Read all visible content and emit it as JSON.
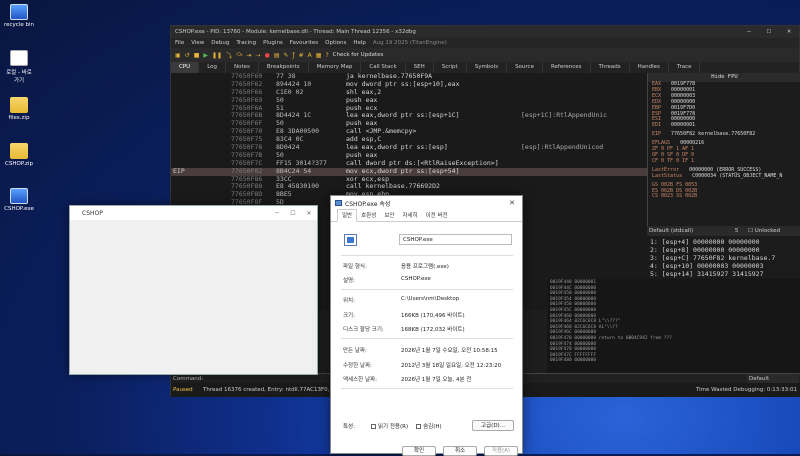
{
  "desktop": {
    "icons": [
      {
        "label": "recycle bin",
        "type": "app"
      },
      {
        "label": "로컬 - 바로 가기",
        "type": "doc"
      },
      {
        "label": "files.zip",
        "type": "folder"
      },
      {
        "label": "CSHOP.zip",
        "type": "folder"
      },
      {
        "label": "CSHOP.exe",
        "type": "app"
      }
    ]
  },
  "debugger": {
    "title": "CSHOP.exe - PID: 13760 - Module: kernelbase.dll - Thread: Main Thread 12356 - x32dbg",
    "menu": [
      "File",
      "View",
      "Debug",
      "Tracing",
      "Plugins",
      "Favourites",
      "Options",
      "Help",
      "Aug 19 2025 (TitanEngine)"
    ],
    "toolbar_text": "Check for Updates",
    "tabs": [
      "CPU",
      "Log",
      "Notes",
      "Breakpoints",
      "Memory Map",
      "Call Stack",
      "SEH",
      "Script",
      "Symbols",
      "Source",
      "References",
      "Threads",
      "Handles",
      "Trace"
    ],
    "eip_label": "EIP",
    "disasm": [
      {
        "addr": "77650F60",
        "bytes": "77 38",
        "instr": "ja kernelbase.77650F9A",
        "cmt": "",
        "cls": "kw-jmp"
      },
      {
        "addr": "77650F62",
        "bytes": "894424 10",
        "instr": "mov dword ptr ss:[esp+10],eax",
        "cmt": "",
        "cls": "kw-mov"
      },
      {
        "addr": "77650F66",
        "bytes": "C1E0 02",
        "instr": "shl eax,2",
        "cmt": "",
        "cls": "kw-mov"
      },
      {
        "addr": "77650F69",
        "bytes": "50",
        "instr": "push eax",
        "cmt": "",
        "cls": "kw-push"
      },
      {
        "addr": "77650F6A",
        "bytes": "51",
        "instr": "push ecx",
        "cmt": "",
        "cls": "kw-push"
      },
      {
        "addr": "77650F6B",
        "bytes": "8D4424 1C",
        "instr": "lea eax,dword ptr ss:[esp+1C]",
        "cmt": "[esp+1C]:RtlAppendUnic",
        "cls": "kw-mov"
      },
      {
        "addr": "77650F6F",
        "bytes": "50",
        "instr": "push eax",
        "cmt": "",
        "cls": "kw-push"
      },
      {
        "addr": "77650F70",
        "bytes": "E8 3DA00500",
        "instr": "call <JMP.&memcpy>",
        "cmt": "",
        "cls": "kw-call"
      },
      {
        "addr": "77650F75",
        "bytes": "83C4 0C",
        "instr": "add esp,C",
        "cmt": "",
        "cls": "kw-mov"
      },
      {
        "addr": "77650F78",
        "bytes": "8D0424",
        "instr": "lea eax,dword ptr ss:[esp]",
        "cmt": "[esp]:RtlAppendUnicod",
        "cls": "kw-mov"
      },
      {
        "addr": "77650F7B",
        "bytes": "50",
        "instr": "push eax",
        "cmt": "",
        "cls": "kw-push"
      },
      {
        "addr": "77650F7C",
        "bytes": "FF15 3014?377",
        "instr": "call dword ptr ds:[<RtlRaiseException>]",
        "cmt": "",
        "cls": "kw-call"
      },
      {
        "addr": "77650F82",
        "bytes": "8B4C24 54",
        "instr": "mov ecx,dword ptr ss:[esp+54]",
        "cmt": "",
        "cls": "kw-mov",
        "hl": true
      },
      {
        "addr": "77650F86",
        "bytes": "33CC",
        "instr": "xor ecx,esp",
        "cmt": "",
        "cls": "kw-mov"
      },
      {
        "addr": "77650F88",
        "bytes": "E8 45830100",
        "instr": "call kernelbase.776692D2",
        "cmt": "",
        "cls": "kw-call"
      },
      {
        "addr": "77650F8D",
        "bytes": "8BE5",
        "instr": "mov esp,ebp",
        "cmt": "",
        "cls": "kw-mov"
      },
      {
        "addr": "77650F8F",
        "bytes": "5D",
        "instr": "pop ebp",
        "cmt": "",
        "cls": "kw-push"
      },
      {
        "addr": "77650F90",
        "bytes": "C2",
        "instr": "",
        "cmt": "",
        "cls": "kw-mov"
      },
      {
        "addr": "77650F93",
        "bytes": "E",
        "instr": "",
        "cmt": "",
        "cls": "kw-mov"
      },
      {
        "addr": "77650F95",
        "bytes": "E",
        "instr": "",
        "cmt": "",
        "cls": "kw-mov"
      },
      {
        "addr": "77650F98",
        "bytes": "E",
        "instr": "",
        "cmt": "",
        "cls": "kw-mov"
      }
    ],
    "regs_header": "Hide FPU",
    "registers": [
      {
        "n": "EAX",
        "v": "0019F778"
      },
      {
        "n": "EBX",
        "v": "00000001"
      },
      {
        "n": "ECX",
        "v": "00000003"
      },
      {
        "n": "EDX",
        "v": "00000000"
      },
      {
        "n": "EBP",
        "v": "0019F7D0"
      },
      {
        "n": "ESP",
        "v": "0019F778"
      },
      {
        "n": "ESI",
        "v": "00000000"
      },
      {
        "n": "EDI",
        "v": "00000001"
      },
      {
        "n": "",
        "v": ""
      },
      {
        "n": "EIP",
        "v": "77650F82   kernelbase.77650F82"
      },
      {
        "n": "",
        "v": ""
      },
      {
        "n": "EFLAGS",
        "v": "00000216"
      },
      {
        "n": "ZF 0  PF 1  AF 1",
        "v": ""
      },
      {
        "n": "OF 0  SF 0  DF 0",
        "v": ""
      },
      {
        "n": "CF 0  TF 0  IF 1",
        "v": ""
      },
      {
        "n": "",
        "v": ""
      },
      {
        "n": "LastError",
        "v": "00000000 (ERROR_SUCCESS)"
      },
      {
        "n": "LastStatus",
        "v": "C0000034 (STATUS_OBJECT_NAME_N"
      },
      {
        "n": "",
        "v": ""
      },
      {
        "n": "GS 002B  FS 0053",
        "v": ""
      },
      {
        "n": "ES 002B  DS 002B",
        "v": ""
      },
      {
        "n": "CS 0023  SS 002B",
        "v": ""
      }
    ],
    "stack_default": "Default (stdcall)",
    "stack_count": "5",
    "unlocked": "Unlocked",
    "stack_args": [
      "1: [esp+4] 00000000 00000000",
      "2: [esp+8] 00000000 00000000",
      "3: [esp+C] 77650F82 kernelbase.7",
      "4: [esp+10] 00000003 00000003",
      "5: [esp+14] 31415927 31415927"
    ],
    "dump_lines": [
      "0019F448 00000001",
      "0019F44C 00000000",
      "0019F450 00000000",
      "0019F454 00000000",
      "0019F458 00000000",
      "0019F45C 00000000",
      "0019F460 00000000",
      "0019F464 02C6C6C8  L\"\\\\???\"",
      "0019F468 02C6C6C8  AL\"\\\\??",
      "0019F46C 00000000",
      "0019F470 00000000  return to 0B04C942 from ???",
      "0019F474 00000000",
      "0019F478 00000000",
      "0019F47C FFFFFFFF",
      "0019F480 00000000"
    ],
    "command_label": "Command:",
    "command_default": "Default",
    "status_paused": "Paused",
    "status_msg": "Thread 16376 created, Entry: ntdll.77AC13F0, Parameter: 02C6C6C8",
    "status_time": "Time Wasted Debugging: 0:13:33:01"
  },
  "cshop_window": {
    "title": "CSHOP"
  },
  "properties": {
    "title": "CSHOP.exe 속성",
    "tabs": [
      "일반",
      "호환성",
      "보안",
      "자세히",
      "이전 버전"
    ],
    "filename": "CSHOP.exe",
    "fields": [
      {
        "k": "파일 형식:",
        "v": "응용 프로그램(.exe)"
      },
      {
        "k": "설명:",
        "v": "CSHOP.exe"
      },
      {
        "k": "위치:",
        "v": "C:\\Users\\nm\\Desktop"
      },
      {
        "k": "크기:",
        "v": "166KB (170,496 바이트)"
      },
      {
        "k": "디스크 할당 크기:",
        "v": "168KB (172,032 바이트)"
      },
      {
        "k": "만든 날짜:",
        "v": "2026년 1월 7일 수요일, 오전 10:58:15"
      },
      {
        "k": "수정한 날짜:",
        "v": "2012년 3월 18일 일요일, 오전 12:23:20"
      },
      {
        "k": "액세스한 날짜:",
        "v": "2026년 1월 7일 오늘, 4분 전"
      }
    ],
    "attrs_label": "특성:",
    "readonly": "읽기 전용(R)",
    "hidden": "숨김(H)",
    "advanced": "고급(D)...",
    "ok": "확인",
    "cancel": "취소",
    "apply": "적용(A)"
  }
}
